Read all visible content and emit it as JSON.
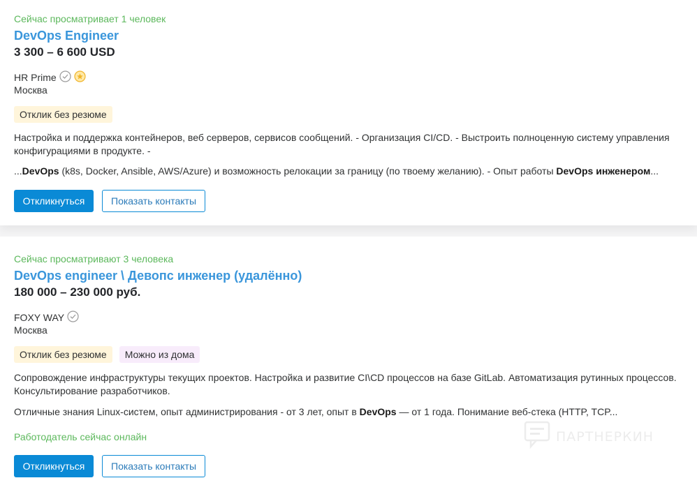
{
  "vacancies": [
    {
      "viewers": "Сейчас просматривает 1 человек",
      "title": "DevOps Engineer",
      "salary": "3 300 – 6 600 USD",
      "company": "HR Prime",
      "city": "Москва",
      "tags": [
        "Отклик без резюме"
      ],
      "snippet_responsibility": "Настройка и поддержка контейнеров, веб серверов, сервисов сообщений. - Организация CI/CD. - Выстроить полноценную систему управления конфигурациями в продукте. -",
      "snippet_req": {
        "p1": "...",
        "b1": "DevOps",
        "p2": " (k8s, Docker, Ansible, AWS/Azure) и возможность релокации за границу (по твоему желанию). - Опыт работы ",
        "b2": "DevOps инженером",
        "p3": "..."
      },
      "respond_label": "Откликнуться",
      "contacts_label": "Показать контакты"
    },
    {
      "viewers": "Сейчас просматривают 3 человека",
      "title": "DevOps engineer \\ Девопс инженер (удалённо)",
      "salary": "180 000 – 230 000 руб.",
      "company": "FOXY WAY",
      "city": "Москва",
      "tags": [
        "Отклик без резюме",
        "Можно из дома"
      ],
      "snippet_responsibility": "Сопровождение инфраструктуры текущих проектов. Настройка и развитие CI\\CD процессов на базе GitLab. Автоматизация рутинных процессов. Консультирование разработчиков.",
      "snippet_req": {
        "p1": "Отличные знания Linux-систем, опыт администрирования - от 3 лет, опыт в ",
        "b1": "DevOps",
        "p2": " — от 1 года. Понимание веб-стека (HTTP, TCP..."
      },
      "online": "Работодатель сейчас онлайн",
      "respond_label": "Откликнуться",
      "contacts_label": "Показать контакты"
    }
  ],
  "watermark": "ПАРТНЕРКИН",
  "colors": {
    "link": "#3a96db",
    "green": "#5cb85c",
    "primary": "#0a8ad6",
    "tag_yellow": "#fff5db",
    "tag_purple": "#f8ecfb"
  }
}
